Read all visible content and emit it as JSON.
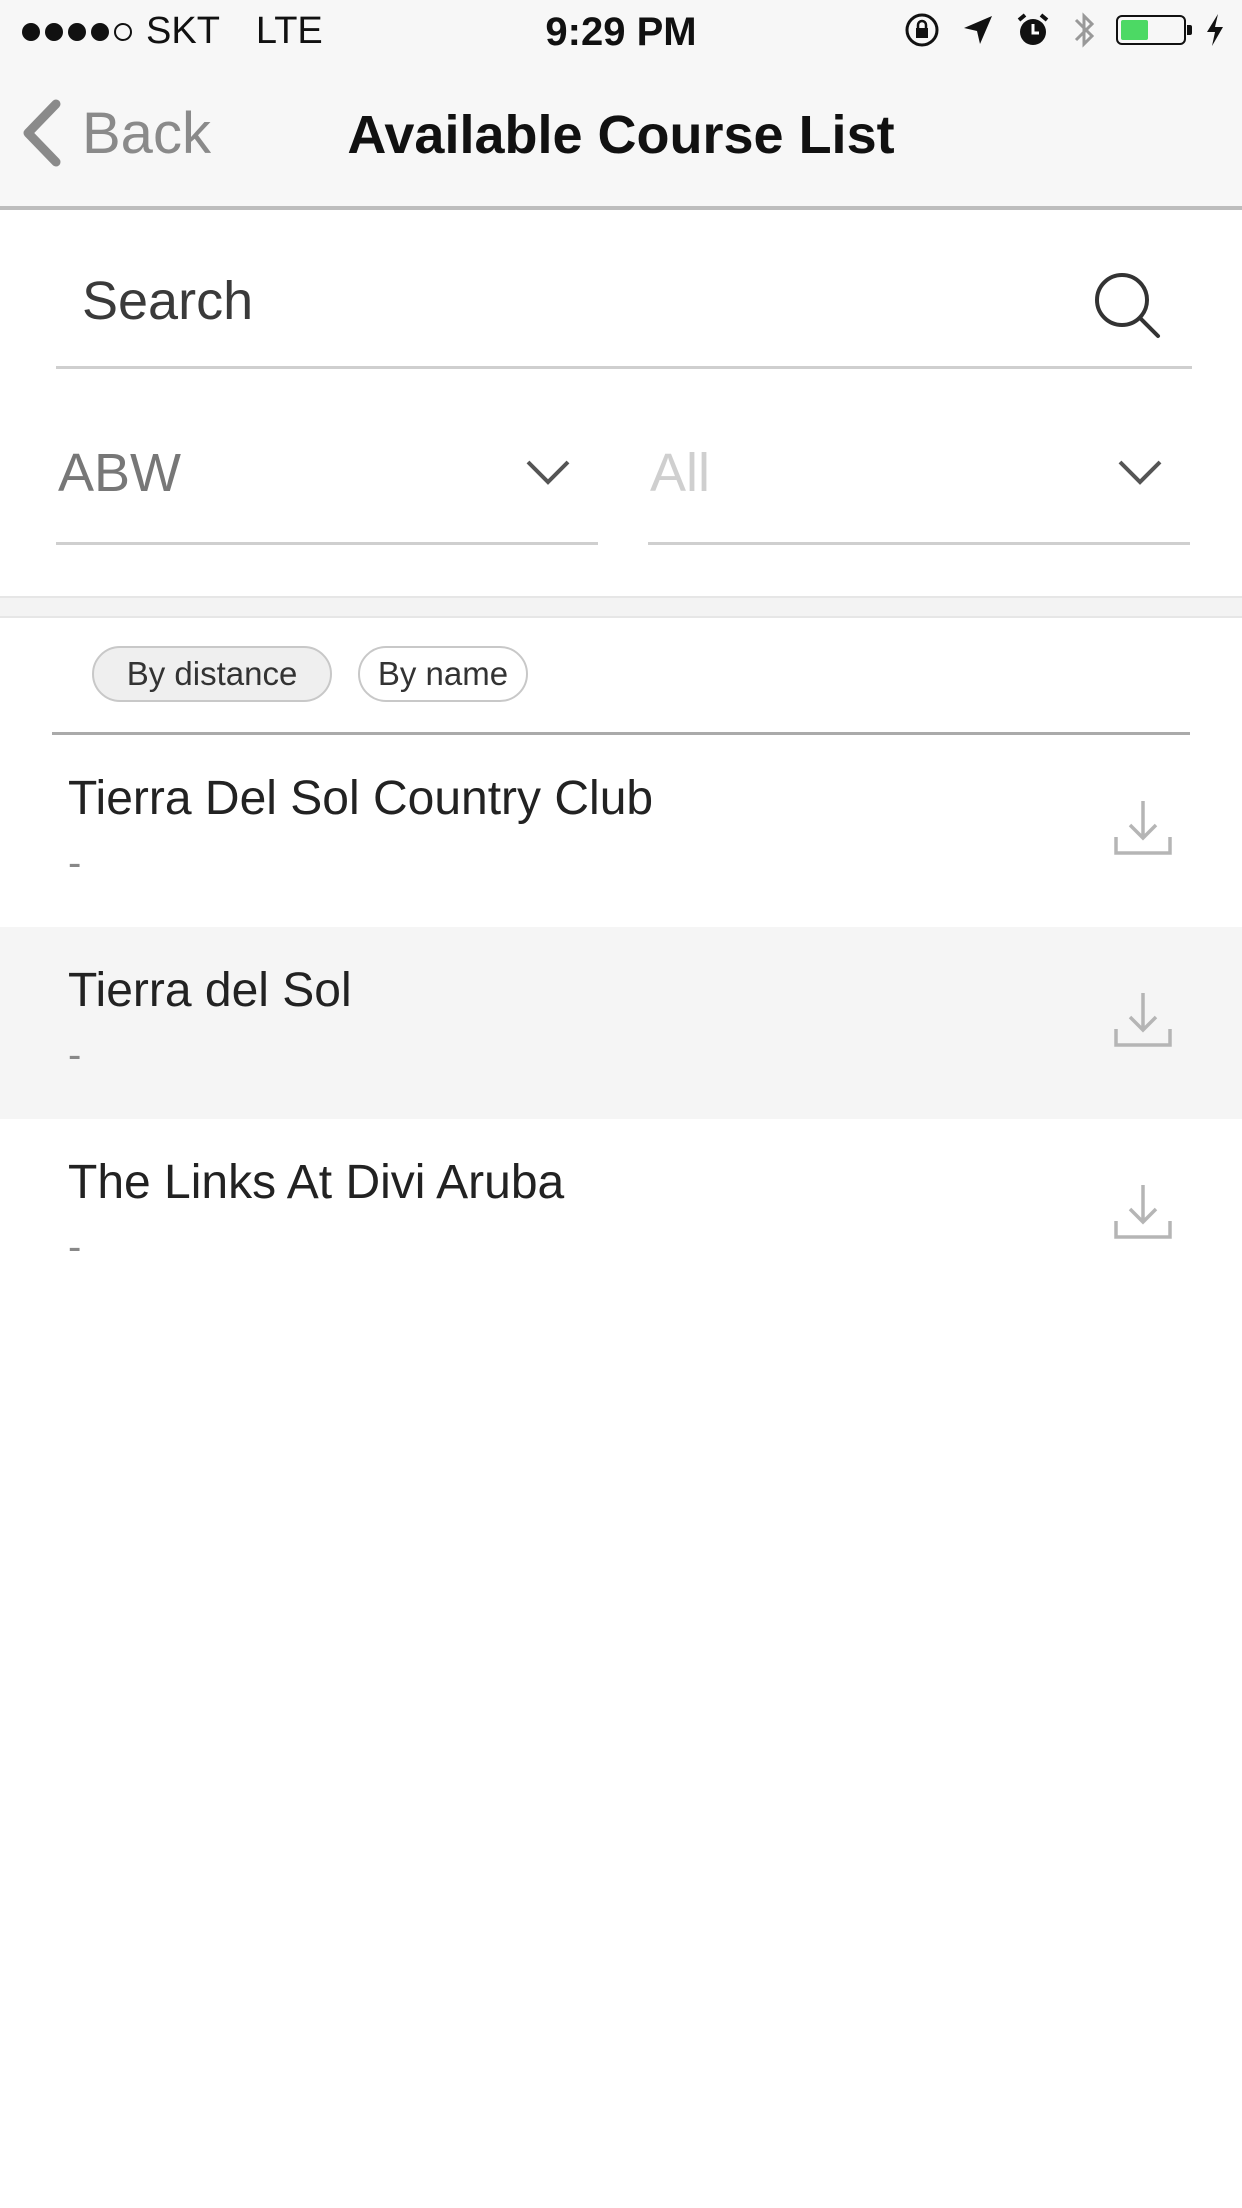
{
  "status_bar": {
    "carrier": "SKT",
    "network": "LTE",
    "time": "9:29 PM",
    "battery_level": 0.45,
    "battery_color": "#4cd964"
  },
  "nav": {
    "back_label": "Back",
    "title": "Available Course List"
  },
  "search": {
    "placeholder": "Search",
    "value": ""
  },
  "filters": {
    "country": "ABW",
    "region": "All"
  },
  "sort": {
    "by_distance": "By distance",
    "by_name": "By name",
    "selected": "By distance"
  },
  "courses": [
    {
      "name": "Tierra Del Sol Country Club",
      "sub": "-"
    },
    {
      "name": "Tierra del Sol",
      "sub": "-"
    },
    {
      "name": "The Links At Divi Aruba",
      "sub": "-"
    }
  ]
}
